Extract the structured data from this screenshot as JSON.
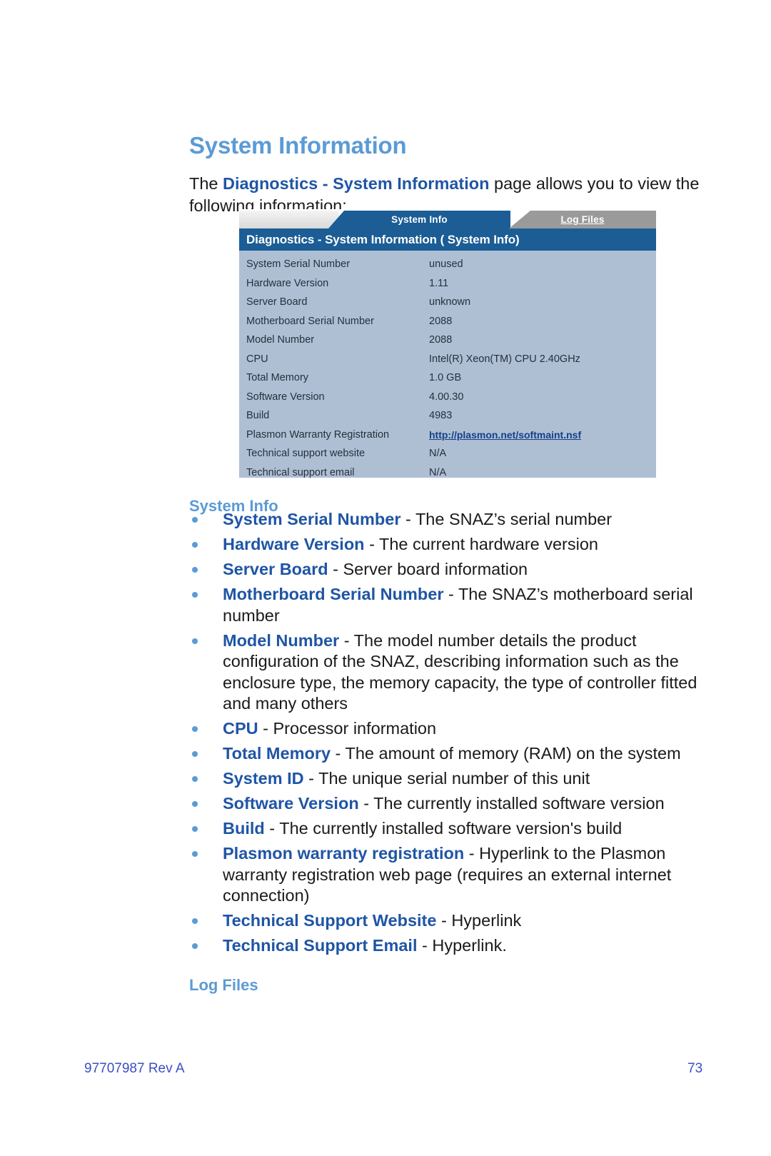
{
  "document": {
    "page_title": "System Information",
    "intro": {
      "before": "The ",
      "bold": "Diagnostics - System Information",
      "after": " page allows you to view the following information:"
    }
  },
  "figure": {
    "tabs": [
      {
        "label": "System Info",
        "active": true
      },
      {
        "label": "Log Files",
        "active": false
      }
    ],
    "title_bar": "Diagnostics - System Information ( System Info)",
    "rows": [
      {
        "key": "System Serial Number",
        "value": "unused",
        "link": false
      },
      {
        "key": "Hardware Version",
        "value": "1.11",
        "link": false
      },
      {
        "key": "Server Board",
        "value": "unknown",
        "link": false
      },
      {
        "key": "Motherboard Serial Number",
        "value": "2088",
        "link": false
      },
      {
        "key": "Model Number",
        "value": "2088",
        "link": false
      },
      {
        "key": "CPU",
        "value": "Intel(R) Xeon(TM) CPU 2.40GHz",
        "link": false
      },
      {
        "key": "Total Memory",
        "value": "1.0 GB",
        "link": false
      },
      {
        "key": "Software Version",
        "value": "4.00.30",
        "link": false
      },
      {
        "key": "Build",
        "value": "4983",
        "link": false
      },
      {
        "key": "Plasmon Warranty Registration",
        "value": "http://plasmon.net/softmaint.nsf",
        "link": true
      },
      {
        "key": "Technical support website",
        "value": "N/A",
        "link": false
      },
      {
        "key": "Technical support email",
        "value": "N/A",
        "link": false
      }
    ]
  },
  "sections": {
    "system_info_heading": "System Info",
    "log_files_heading": "Log Files"
  },
  "bullets": [
    {
      "term": "System Serial Number",
      "desc": " - The SNAZ’s serial number"
    },
    {
      "term": "Hardware Version",
      "desc": " - The current hardware version"
    },
    {
      "term": "Server Board",
      "desc": " - Server board information"
    },
    {
      "term": "Motherboard Serial Number",
      "desc": " - The SNAZ’s motherboard serial number"
    },
    {
      "term": "Model Number",
      "desc": " - The model number details the product configuration of the SNAZ, describing information such as the enclosure type, the memory capacity, the type of controller fitted and many others"
    },
    {
      "term": "CPU",
      "desc": " - Processor information"
    },
    {
      "term": "Total Memory",
      "desc": " - The amount of memory (RAM) on the system"
    },
    {
      "term": "System ID",
      "desc": " - The unique serial number of this unit"
    },
    {
      "term": "Software Version",
      "desc": " - The currently installed software version"
    },
    {
      "term": "Build",
      "desc": " - The currently installed software version's build"
    },
    {
      "term": "Plasmon warranty registration",
      "desc": " - Hyperlink to the Plasmon warranty registration web page (requires an external internet connection)"
    },
    {
      "term": "Technical Support Website",
      "desc": " - Hyperlink"
    },
    {
      "term": "Technical Support Email",
      "desc": " - Hyperlink."
    }
  ],
  "footer": {
    "document_number": "97707987 Rev A",
    "page_number": "73"
  },
  "colors": {
    "heading_blue": "#5b9bd5",
    "term_blue": "#1f55a5",
    "ui_titlebar": "#1b5d94",
    "ui_table_bg": "#aebfd4",
    "ui_inactive_tab": "#9a9a9a",
    "footer_blue": "#3b4fc4"
  }
}
